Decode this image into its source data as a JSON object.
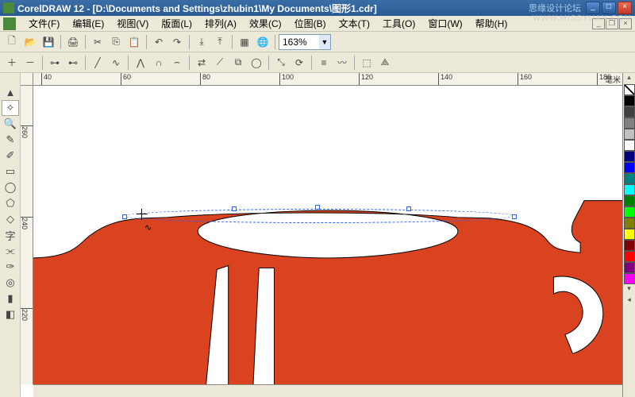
{
  "app": {
    "title": "CorelDRAW 12 - [D:\\Documents and Settings\\zhubin1\\My Documents\\图形1.cdr]",
    "watermark": "思缘设计论坛",
    "url_watermark": "WWW.MISSYUAN.COM"
  },
  "menu": {
    "items": [
      {
        "label": "文件(F)"
      },
      {
        "label": "编辑(E)"
      },
      {
        "label": "视图(V)"
      },
      {
        "label": "版面(L)"
      },
      {
        "label": "排列(A)"
      },
      {
        "label": "效果(C)"
      },
      {
        "label": "位图(B)"
      },
      {
        "label": "文本(T)"
      },
      {
        "label": "工具(O)"
      },
      {
        "label": "窗口(W)"
      },
      {
        "label": "帮助(H)"
      }
    ]
  },
  "toolbar": {
    "zoom": "163%"
  },
  "ruler": {
    "unit": "毫米",
    "hticks": [
      "40",
      "60",
      "80",
      "100",
      "120",
      "140",
      "160",
      "180"
    ],
    "vticks": [
      "260",
      "240",
      "220"
    ]
  },
  "palette": {
    "colors": [
      "#000000",
      "#404040",
      "#808080",
      "#c0c0c0",
      "#ffffff",
      "#000080",
      "#0000ff",
      "#008080",
      "#00ffff",
      "#008000",
      "#00ff00",
      "#808000",
      "#ffff00",
      "#800000",
      "#ff0000",
      "#800080",
      "#ff00ff"
    ]
  },
  "artwork": {
    "fill": "#d9431f"
  }
}
